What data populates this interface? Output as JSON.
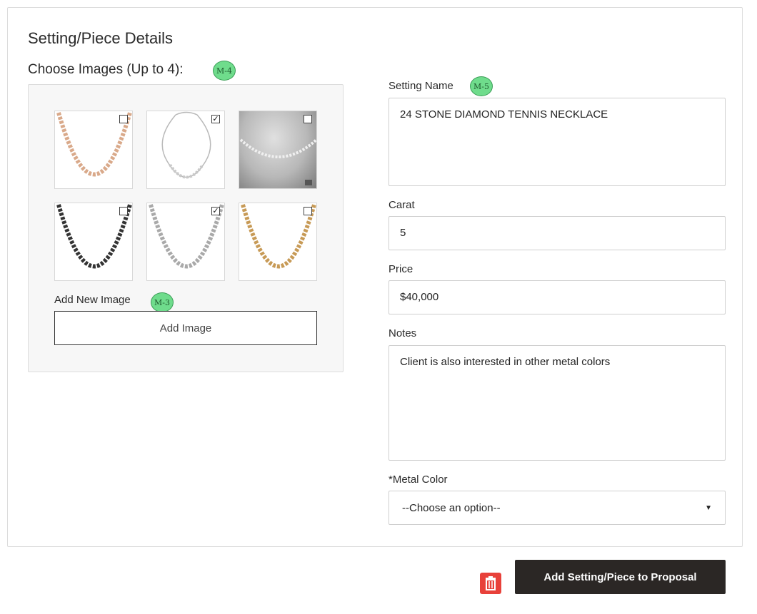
{
  "section_title": "Setting/Piece Details",
  "images": {
    "label": "Choose Images (Up to 4):",
    "marker": "M-4",
    "thumbnails": [
      {
        "alt": "rose-gold-necklace",
        "checked": false,
        "metal": "#d9a98a"
      },
      {
        "alt": "white-gold-full-necklace",
        "checked": true,
        "metal": "#b9b9b9"
      },
      {
        "alt": "necklace-on-grey",
        "checked": false,
        "metal": "#e6e6e6"
      },
      {
        "alt": "black-rhodium-necklace",
        "checked": false,
        "metal": "#333333"
      },
      {
        "alt": "white-gold-necklace",
        "checked": true,
        "metal": "#a9a9a9"
      },
      {
        "alt": "yellow-gold-necklace",
        "checked": false,
        "metal": "#c79a56"
      }
    ],
    "add_new_label": "Add New Image",
    "add_new_marker": "M-3",
    "add_button_label": "Add Image"
  },
  "form": {
    "setting_name_label": "Setting Name",
    "setting_name_marker": "M-5",
    "setting_name_value": "24 STONE DIAMOND TENNIS NECKLACE",
    "carat_label": "Carat",
    "carat_value": "5",
    "price_label": "Price",
    "price_value": "$40,000",
    "notes_label": "Notes",
    "notes_value": "Client is also interested in other metal colors",
    "metal_color_label": "*Metal Color",
    "metal_color_selected": "--Choose an option--"
  },
  "actions": {
    "add_to_proposal_label": "Add Setting/Piece to Proposal",
    "delete_icon": "trash-icon"
  },
  "colors": {
    "primary_button": "#2b2725",
    "marker_fill": "#6fdc8c",
    "delete_red": "#e8413a"
  }
}
